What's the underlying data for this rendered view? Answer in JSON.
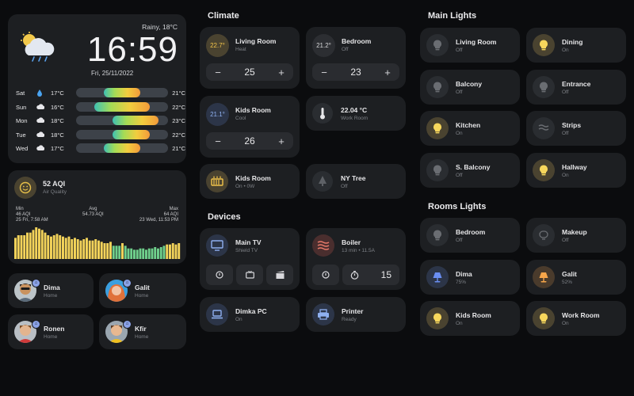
{
  "weather": {
    "condition": "Rainy, 18°C",
    "time": "16:59",
    "date": "Fri, 25/11/2022",
    "forecast": [
      {
        "day": "Sat",
        "icon": "rain-drop-icon",
        "low": "17°C",
        "high": "21°C",
        "from": 0.17,
        "to": 0.21
      },
      {
        "day": "Sun",
        "icon": "cloud-icon",
        "low": "16°C",
        "high": "22°C",
        "from": 0.16,
        "to": 0.22
      },
      {
        "day": "Mon",
        "icon": "cloud-icon",
        "low": "18°C",
        "high": "23°C",
        "from": 0.18,
        "to": 0.23
      },
      {
        "day": "Tue",
        "icon": "cloud-icon",
        "low": "18°C",
        "high": "22°C",
        "from": 0.18,
        "to": 0.22
      },
      {
        "day": "Wed",
        "icon": "cloud-icon",
        "low": "17°C",
        "high": "21°C",
        "from": 0.17,
        "to": 0.21
      }
    ]
  },
  "aqi": {
    "value": "52 AQI",
    "label": "Air Quality",
    "min_label": "Min",
    "min_value": "46 AQI",
    "min_time": "25 Fri, 7:58 AM",
    "avg_label": "Avg",
    "avg_value": "54.73 AQI",
    "max_label": "Max",
    "max_value": "64 AQI",
    "max_time": "23 Wed, 11:53 PM",
    "history": [
      56,
      58,
      58,
      58,
      60,
      60,
      62,
      64,
      63,
      62,
      60,
      58,
      57,
      58,
      59,
      58,
      57,
      56,
      57,
      55,
      56,
      55,
      54,
      55,
      56,
      54,
      54,
      55,
      54,
      53,
      52,
      52,
      53,
      50,
      50,
      50,
      52,
      50,
      48,
      48,
      47,
      47,
      48,
      48,
      47,
      48,
      48,
      49,
      48,
      49,
      50,
      51,
      51,
      52,
      51,
      52
    ]
  },
  "people": [
    {
      "name": "Dima",
      "status": "Home"
    },
    {
      "name": "Galit",
      "status": "Home"
    },
    {
      "name": "Ronen",
      "status": "Home"
    },
    {
      "name": "Kfir",
      "status": "Home"
    }
  ],
  "climate": {
    "title": "Climate",
    "living_room": {
      "temp": "22.7°",
      "name": "Living Room",
      "mode": "Heat",
      "setpoint": "25"
    },
    "bedroom": {
      "temp": "21.2°",
      "name": "Bedroom",
      "mode": "Off",
      "setpoint": "23"
    },
    "kids_room": {
      "temp": "21.1°",
      "name": "Kids Room",
      "mode": "Cool",
      "setpoint": "26"
    },
    "work_room": {
      "temp": "22.04 °C",
      "name": "Work Room"
    },
    "kids_heater": {
      "name": "Kids Room",
      "status": "On • 0W"
    },
    "ny_tree": {
      "name": "NY Tree",
      "status": "Off"
    },
    "minus": "−",
    "plus": "+"
  },
  "devices": {
    "title": "Devices",
    "main_tv": {
      "name": "Main TV",
      "sub": "Shield TV"
    },
    "boiler": {
      "name": "Boiler",
      "sub": "13 min • 11.5A",
      "timer": "15"
    },
    "pc": {
      "name": "Dimka PC",
      "sub": "On"
    },
    "printer": {
      "name": "Printer",
      "sub": "Ready"
    }
  },
  "main_lights": {
    "title": "Main Lights",
    "items": [
      {
        "name": "Living Room",
        "state": "Off",
        "on": false
      },
      {
        "name": "Dining",
        "state": "On",
        "on": true
      },
      {
        "name": "Balcony",
        "state": "Off",
        "on": false
      },
      {
        "name": "Entrance",
        "state": "Off",
        "on": false
      },
      {
        "name": "Kitchen",
        "state": "On",
        "on": true
      },
      {
        "name": "Strips",
        "state": "Off",
        "on": false
      },
      {
        "name": "S. Balcony",
        "state": "Off",
        "on": false
      },
      {
        "name": "Hallway",
        "state": "On",
        "on": true
      }
    ]
  },
  "rooms_lights": {
    "title": "Rooms Lights",
    "items": [
      {
        "name": "Bedroom",
        "state": "Off",
        "on": false
      },
      {
        "name": "Makeup",
        "state": "Off",
        "on": false
      },
      {
        "name": "Dima",
        "state": "75%",
        "on": true
      },
      {
        "name": "Galit",
        "state": "52%",
        "on": true
      },
      {
        "name": "Kids Room",
        "state": "On",
        "on": true
      },
      {
        "name": "Work Room",
        "state": "On",
        "on": true
      }
    ]
  },
  "colors": {
    "bg": "#0b0c0e",
    "card": "#1d1f22",
    "on_yellow": "#f7d75c",
    "aqi_bar": "#f3d35a",
    "aqi_good": "#6fd08c"
  }
}
